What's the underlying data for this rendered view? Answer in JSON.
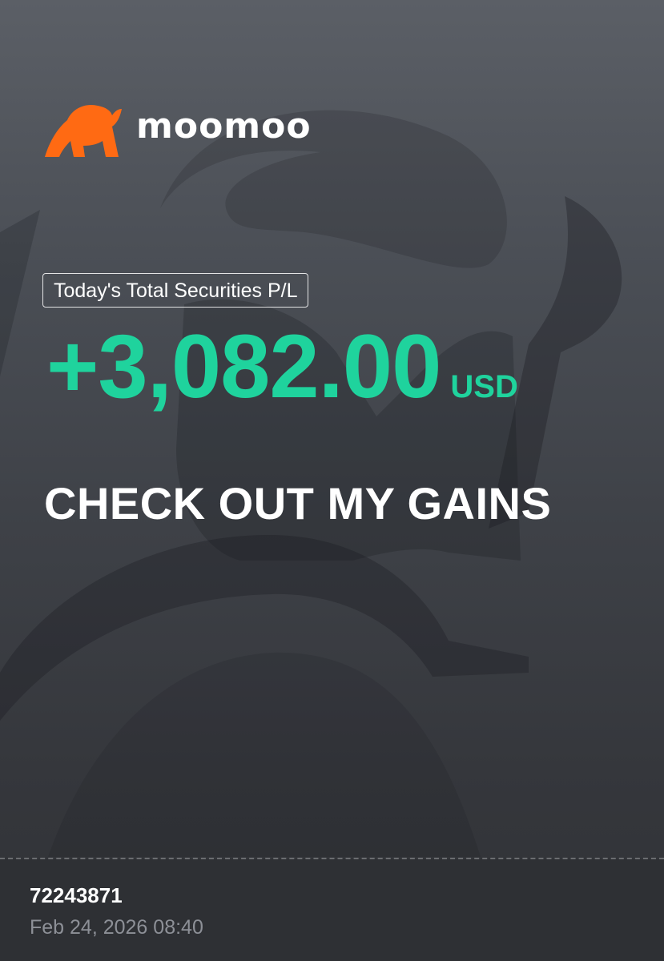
{
  "brand": {
    "name": "moomoo",
    "logo_icon": "bull-head-icon",
    "accent_color": "#ff6a13"
  },
  "profit_loss": {
    "label": "Today's Total Securities P/L",
    "value": "+3,082.00",
    "currency": "USD",
    "value_color": "#1fd39d"
  },
  "headline": "CHECK OUT MY GAINS",
  "footer": {
    "account_id": "72243871",
    "timestamp": "Feb 24, 2026 08:40"
  }
}
